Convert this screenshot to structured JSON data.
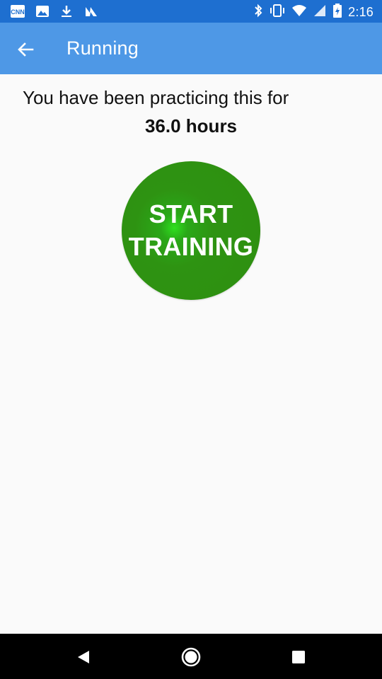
{
  "status_bar": {
    "time": "2:16",
    "icons_left": [
      "cnn-icon",
      "image-icon",
      "download-icon",
      "n-icon"
    ],
    "icons_right": [
      "bluetooth-icon",
      "vibrate-icon",
      "wifi-icon",
      "signal-icon",
      "battery-icon"
    ],
    "color": "#1e6fd0"
  },
  "app_bar": {
    "title": "Running",
    "color": "#4e98e6"
  },
  "main": {
    "practice_text": "You have been practicing this for",
    "hours_text": "36.0 hours",
    "start_button": {
      "line1": "START",
      "line2": "TRAINING",
      "color": "#2e8f10"
    }
  },
  "nav_bar": {
    "back": "back-icon",
    "home": "home-icon",
    "recents": "recents-icon"
  }
}
